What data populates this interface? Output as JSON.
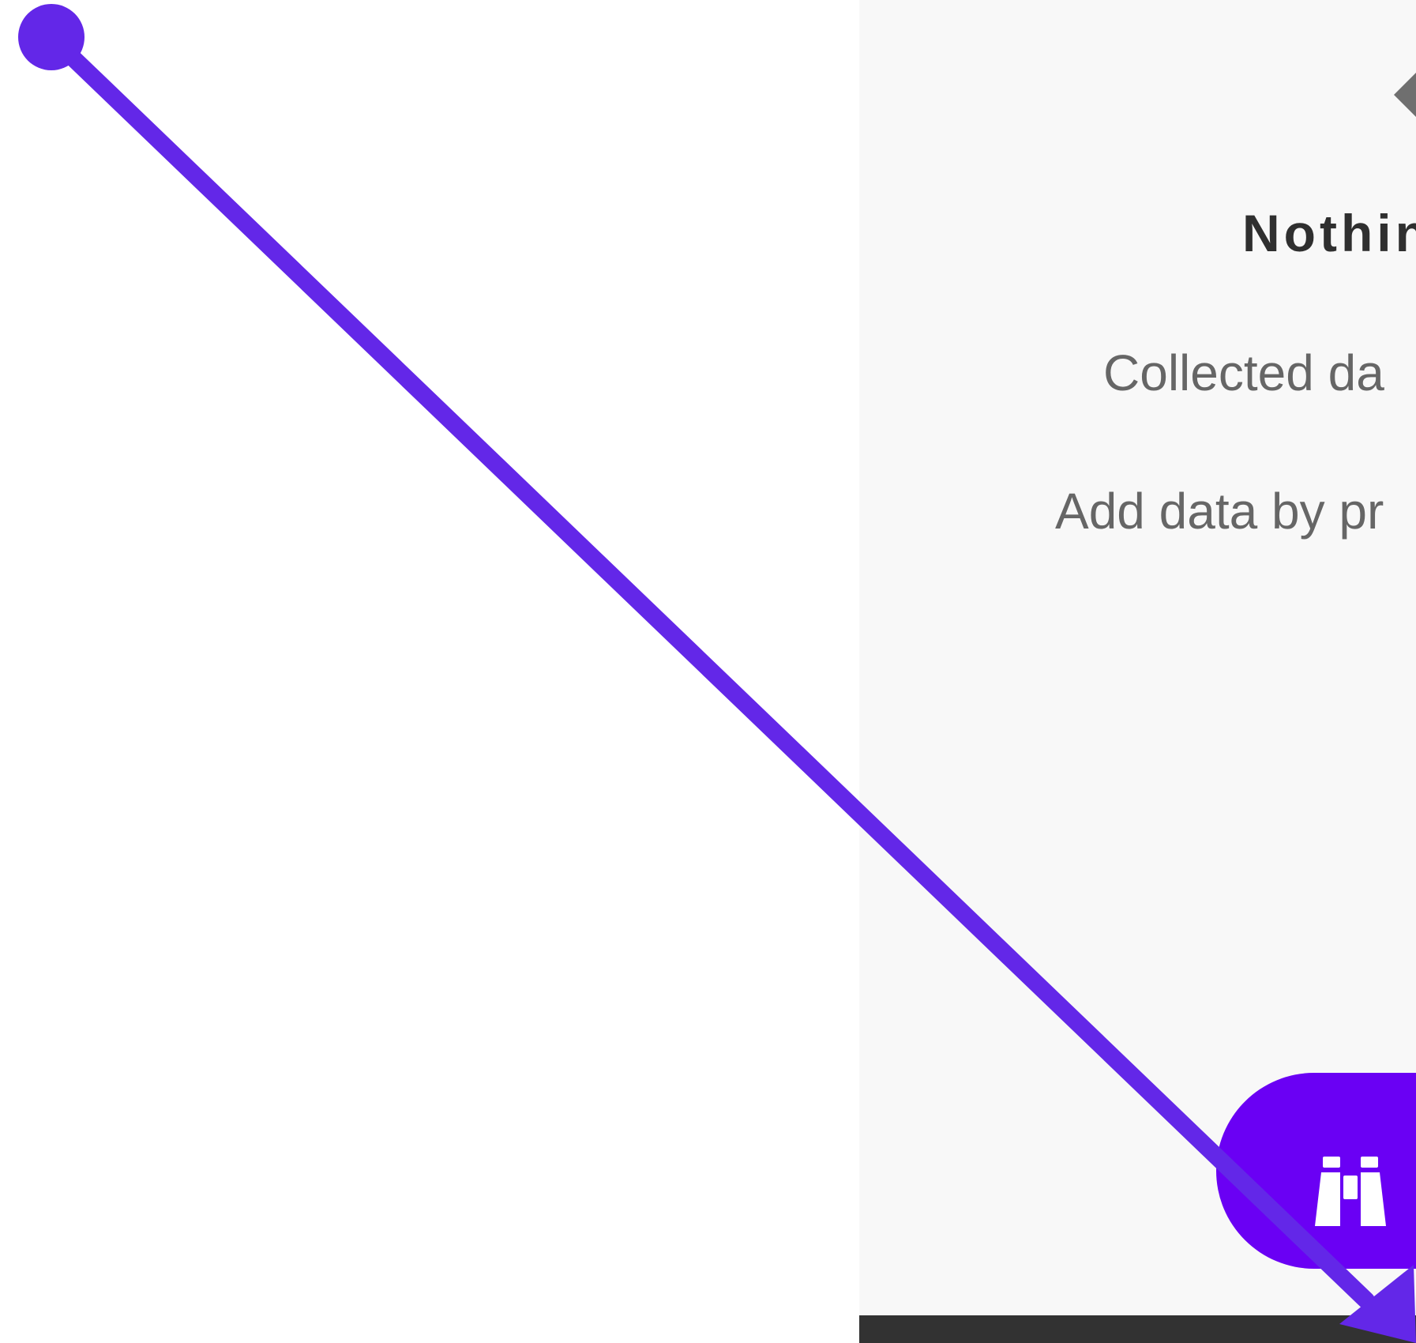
{
  "empty_state": {
    "icon": "edit-diamond-icon",
    "title": "Nothin",
    "line_1": "Collected da",
    "line_2": "Add data by pr"
  },
  "fab": {
    "icon": "binoculars-icon",
    "color": "#6a00f4"
  },
  "annotation": {
    "type": "arrow",
    "color": "#6327e8"
  },
  "colors": {
    "panel_background": "#f8f8f8",
    "bottom_bar": "#323232",
    "title_text": "#2f2f2f",
    "body_text": "#666666"
  }
}
